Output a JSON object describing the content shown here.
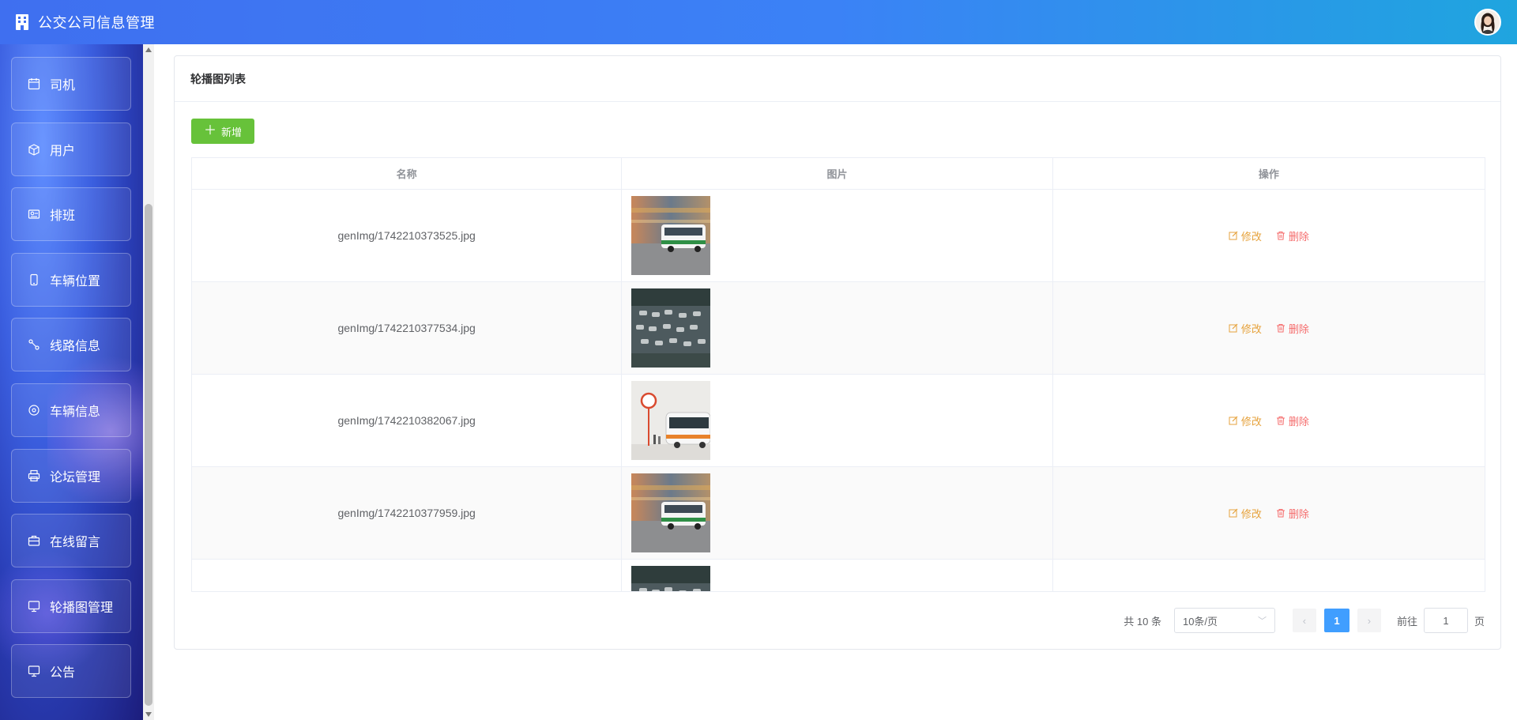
{
  "header": {
    "title": "公交公司信息管理",
    "logo_icon": "building-icon",
    "avatar_icon": "user-avatar"
  },
  "sidebar": {
    "items": [
      {
        "label": "司机",
        "icon": "calendar-icon"
      },
      {
        "label": "用户",
        "icon": "box-icon"
      },
      {
        "label": "排班",
        "icon": "id-card-icon"
      },
      {
        "label": "车辆位置",
        "icon": "phone-icon"
      },
      {
        "label": "线路信息",
        "icon": "route-icon"
      },
      {
        "label": "车辆信息",
        "icon": "circle-icon"
      },
      {
        "label": "论坛管理",
        "icon": "printer-icon"
      },
      {
        "label": "在线留言",
        "icon": "suitcase-icon"
      },
      {
        "label": "轮播图管理",
        "icon": "monitor-icon"
      },
      {
        "label": "公告",
        "icon": "monitor-icon"
      }
    ]
  },
  "card": {
    "title": "轮播图列表",
    "add_label": "新增"
  },
  "table": {
    "columns": [
      "名称",
      "图片",
      "操作"
    ],
    "rows": [
      {
        "name": "genImg/1742210373525.jpg",
        "image": "bus-motion"
      },
      {
        "name": "genImg/1742210377534.jpg",
        "image": "parking-lot"
      },
      {
        "name": "genImg/1742210382067.jpg",
        "image": "bus-stop-clock"
      },
      {
        "name": "genImg/1742210377959.jpg",
        "image": "bus-motion"
      },
      {
        "name": "",
        "image": "parking-lot"
      }
    ],
    "edit_label": "修改",
    "delete_label": "删除"
  },
  "pagination": {
    "total": "共 10 条",
    "page_size": "10条/页",
    "current_page": "1",
    "goto_label": "前往",
    "goto_value": "1",
    "page_suffix": "页"
  },
  "colors": {
    "header_start": "#3f6ff0",
    "header_end": "#1fa5df",
    "add_button": "#67c23a",
    "edit": "#e6a23c",
    "delete": "#f56c6c",
    "page_active": "#409eff"
  }
}
